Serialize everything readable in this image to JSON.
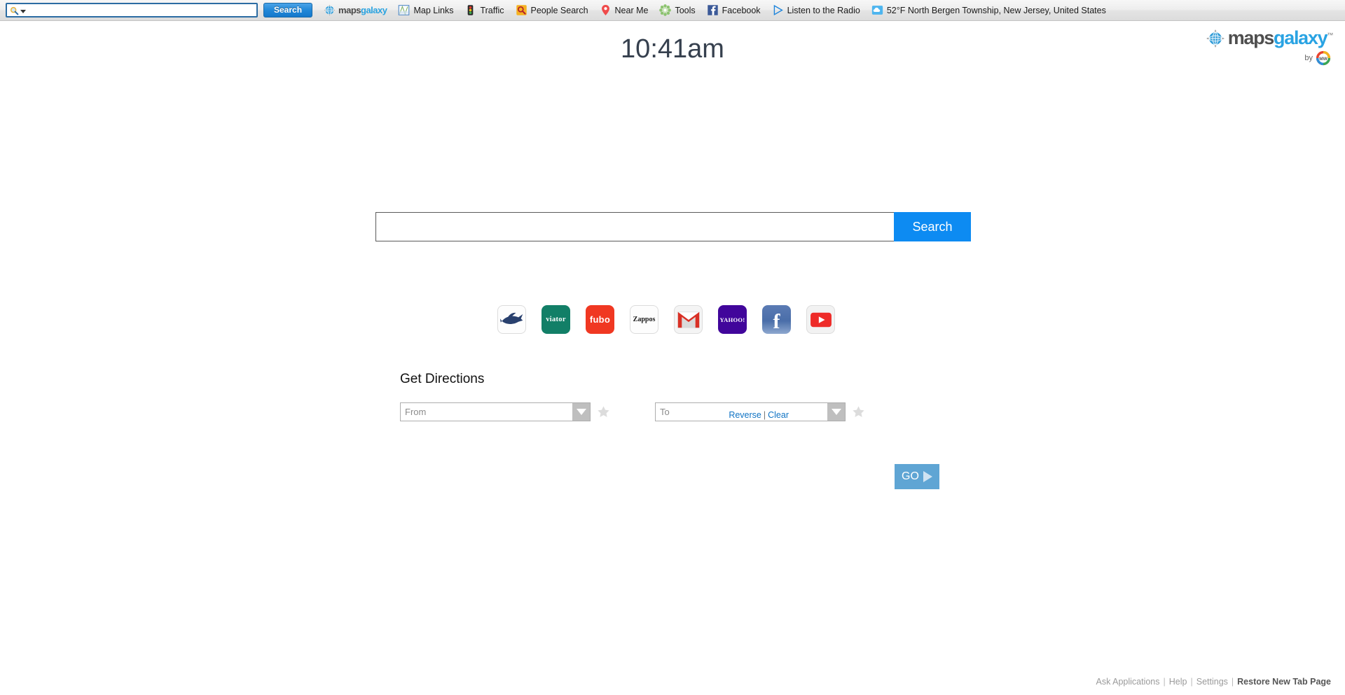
{
  "toolbar": {
    "search_value": "",
    "search_placeholder": "",
    "search_icon": "magnifier-dropdown-icon",
    "search_button_label": "Search",
    "items": [
      {
        "label": "mapsgalaxy",
        "label_a": "maps",
        "label_b": "galaxy",
        "icon": "mapsgalaxy-globe-icon"
      },
      {
        "label": "Map Links",
        "icon": "map-links-icon"
      },
      {
        "label": "Traffic",
        "icon": "traffic-light-icon"
      },
      {
        "label": "People Search",
        "icon": "people-search-icon"
      },
      {
        "label": "Near Me",
        "icon": "map-pin-icon"
      },
      {
        "label": "Tools",
        "icon": "gear-flower-icon"
      },
      {
        "label": "Facebook",
        "icon": "facebook-icon"
      },
      {
        "label": "Listen to the Radio",
        "icon": "play-triangle-icon"
      },
      {
        "label": "52°F North Bergen Township, New Jersey, United States",
        "icon": "weather-cloud-icon"
      }
    ]
  },
  "brand": {
    "name_part1": "maps",
    "name_part2": "galaxy",
    "trademark": "™",
    "by_label": "by",
    "by_badge": "MW",
    "globe_icon": "globe-compass-icon"
  },
  "clock": {
    "time": "10:41am"
  },
  "main_search": {
    "value": "",
    "placeholder": "",
    "button_label": "Search"
  },
  "shortcuts": [
    {
      "name": "marlin-shortcut",
      "label": "",
      "icon": "marlin-fish-icon",
      "bg": "#fdfdfd",
      "light": true
    },
    {
      "name": "viator-shortcut",
      "label": "viator",
      "icon": "viator-icon",
      "bg": "#127f67",
      "light": false
    },
    {
      "name": "fubo-shortcut",
      "label": "fubo",
      "icon": "fubo-icon",
      "bg": "#f03822",
      "light": false
    },
    {
      "name": "zappos-shortcut",
      "label": "Zappos",
      "icon": "zappos-icon",
      "bg": "#fdfdfd",
      "light": true
    },
    {
      "name": "gmail-shortcut",
      "label": "",
      "icon": "gmail-envelope-icon",
      "bg": "#f4f4f4",
      "light": true
    },
    {
      "name": "yahoo-shortcut",
      "label": "YAHOO!",
      "icon": "yahoo-icon",
      "bg": "#41069b",
      "light": false
    },
    {
      "name": "facebook-shortcut",
      "label": "f",
      "icon": "facebook-f-icon",
      "bg": "#4a6ea9",
      "light": false
    },
    {
      "name": "youtube-shortcut",
      "label": "",
      "icon": "youtube-play-icon",
      "bg": "#f2f2f2",
      "light": true
    }
  ],
  "directions": {
    "title": "Get Directions",
    "from": {
      "value": "",
      "placeholder": "From",
      "star": "favorite-star-icon",
      "arrow": "chevron-down-icon"
    },
    "to": {
      "value": "",
      "placeholder": "To",
      "star": "favorite-star-icon",
      "arrow": "chevron-down-icon"
    },
    "reverse_label": "Reverse",
    "separator": "|",
    "clear_label": "Clear",
    "go_label": "GO",
    "go_icon": "play-triangle-icon"
  },
  "footer": {
    "ask_applications": "Ask Applications",
    "help": "Help",
    "settings": "Settings",
    "restore": "Restore New Tab Page",
    "separator": "|"
  },
  "colors": {
    "accent_blue": "#0d8bf2",
    "go_blue": "#5fa5d4",
    "link_blue": "#0f73c4",
    "clock_slate": "#36404e",
    "brand_blue": "#29a3e3"
  }
}
